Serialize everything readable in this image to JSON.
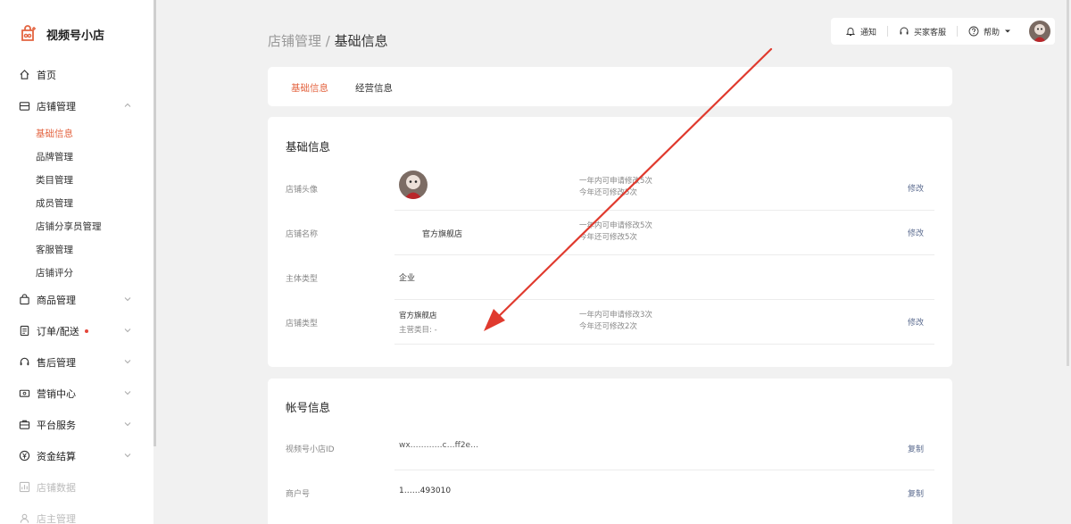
{
  "app": {
    "name": "视频号小店"
  },
  "sidebar": {
    "items": [
      {
        "label": "首页",
        "icon": "home-icon"
      },
      {
        "label": "店铺管理",
        "icon": "store-icon",
        "expanded": true,
        "children": [
          "基础信息",
          "品牌管理",
          "类目管理",
          "成员管理",
          "店铺分享员管理",
          "客服管理",
          "店铺评分"
        ],
        "active_child": "基础信息"
      },
      {
        "label": "商品管理",
        "icon": "bag-icon"
      },
      {
        "label": "订单/配送",
        "icon": "order-icon",
        "badge_dot": true
      },
      {
        "label": "售后管理",
        "icon": "headset-icon"
      },
      {
        "label": "营销中心",
        "icon": "ticket-icon"
      },
      {
        "label": "平台服务",
        "icon": "briefcase-icon"
      },
      {
        "label": "资金结算",
        "icon": "yen-icon"
      },
      {
        "label": "店铺数据",
        "icon": "chart-icon"
      },
      {
        "label": "店主管理",
        "icon": "user-icon"
      }
    ]
  },
  "breadcrumb": {
    "parent": "店铺管理",
    "separator": "/",
    "current": "基础信息"
  },
  "topbar": {
    "notify": "通知",
    "service": "买家客服",
    "help": "帮助"
  },
  "tabs": [
    {
      "label": "基础信息",
      "active": true
    },
    {
      "label": "经营信息",
      "active": false
    }
  ],
  "basic_info": {
    "title": "基础信息",
    "rows": {
      "avatar": {
        "label": "店铺头像",
        "note1": "一年内可申请修改5次",
        "note2": "今年还可修改5次",
        "action": "修改"
      },
      "name": {
        "label": "店铺名称",
        "value": "官方旗舰店",
        "note1": "一年内可申请修改5次",
        "note2": "今年还可修改5次",
        "action": "修改"
      },
      "entity": {
        "label": "主体类型",
        "value": "企业"
      },
      "type": {
        "label": "店铺类型",
        "value": "官方旗舰店",
        "sub": "主营类目: -",
        "note1": "一年内可申请修改3次",
        "note2": "今年还可修改2次",
        "action": "修改"
      }
    }
  },
  "account_info": {
    "title": "帐号信息",
    "rows": {
      "shop_id": {
        "label": "视频号小店ID",
        "value": "wx…………c…ff2e…",
        "action": "复制"
      },
      "merchant": {
        "label": "商户号",
        "value": "1……493010",
        "action": "复制"
      }
    }
  },
  "colors": {
    "accent": "#e36440",
    "link": "#5b6b8f",
    "arrow": "#e03a2e"
  }
}
